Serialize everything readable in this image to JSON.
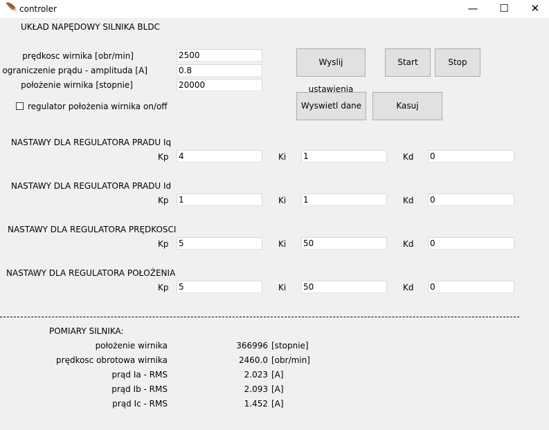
{
  "window": {
    "title": "controler",
    "minimize": "—",
    "maximize": "☐",
    "close": "✕"
  },
  "header": {
    "title": "UKŁAD NAPĘDOWY SILNIKA BLDC"
  },
  "settings": {
    "speed_label": "prędkosc wirnika [obr/min]",
    "speed_value": "2500",
    "current_label": "ograniczenie prądu - amplituda [A]",
    "current_value": "0.8",
    "position_label": "położenie wirnika [stopnie]",
    "position_value": "20000",
    "position_reg_label": "regulator położenia wirnika on/off"
  },
  "buttons": {
    "send": "Wyslij ustawienia",
    "start": "Start",
    "stop": "Stop",
    "show": "Wyswietl dane",
    "clear": "Kasuj"
  },
  "pid_labels": {
    "kp": "Kp",
    "ki": "Ki",
    "kd": "Kd"
  },
  "regulators": [
    {
      "title": "NASTAWY DLA REGULATORA PRADU Iq",
      "kp": "4",
      "ki": "1",
      "kd": "0"
    },
    {
      "title": "NASTAWY DLA REGULATORA PRADU Id",
      "kp": "1",
      "ki": "1",
      "kd": "0"
    },
    {
      "title": "NASTAWY DLA REGULATORA PRĘDKOSCI",
      "kp": "5",
      "ki": "50",
      "kd": "0"
    },
    {
      "title": "NASTAWY DLA REGULATORA POŁOŻENIA",
      "kp": "5",
      "ki": "50",
      "kd": "0"
    }
  ],
  "measurements": {
    "title": "POMIARY SILNIKA:",
    "rows": [
      {
        "label": "położenie wirnika",
        "value": "366996",
        "unit": "[stopnie]"
      },
      {
        "label": "prędkosc obrotowa wirnika",
        "value": "2460.0",
        "unit": "[obr/min]"
      },
      {
        "label": "prąd Ia - RMS",
        "value": "2.023",
        "unit": "[A]"
      },
      {
        "label": "prąd Ib - RMS",
        "value": "2.093",
        "unit": "[A]"
      },
      {
        "label": "prąd Ic - RMS",
        "value": "1.452",
        "unit": "[A]"
      }
    ]
  }
}
